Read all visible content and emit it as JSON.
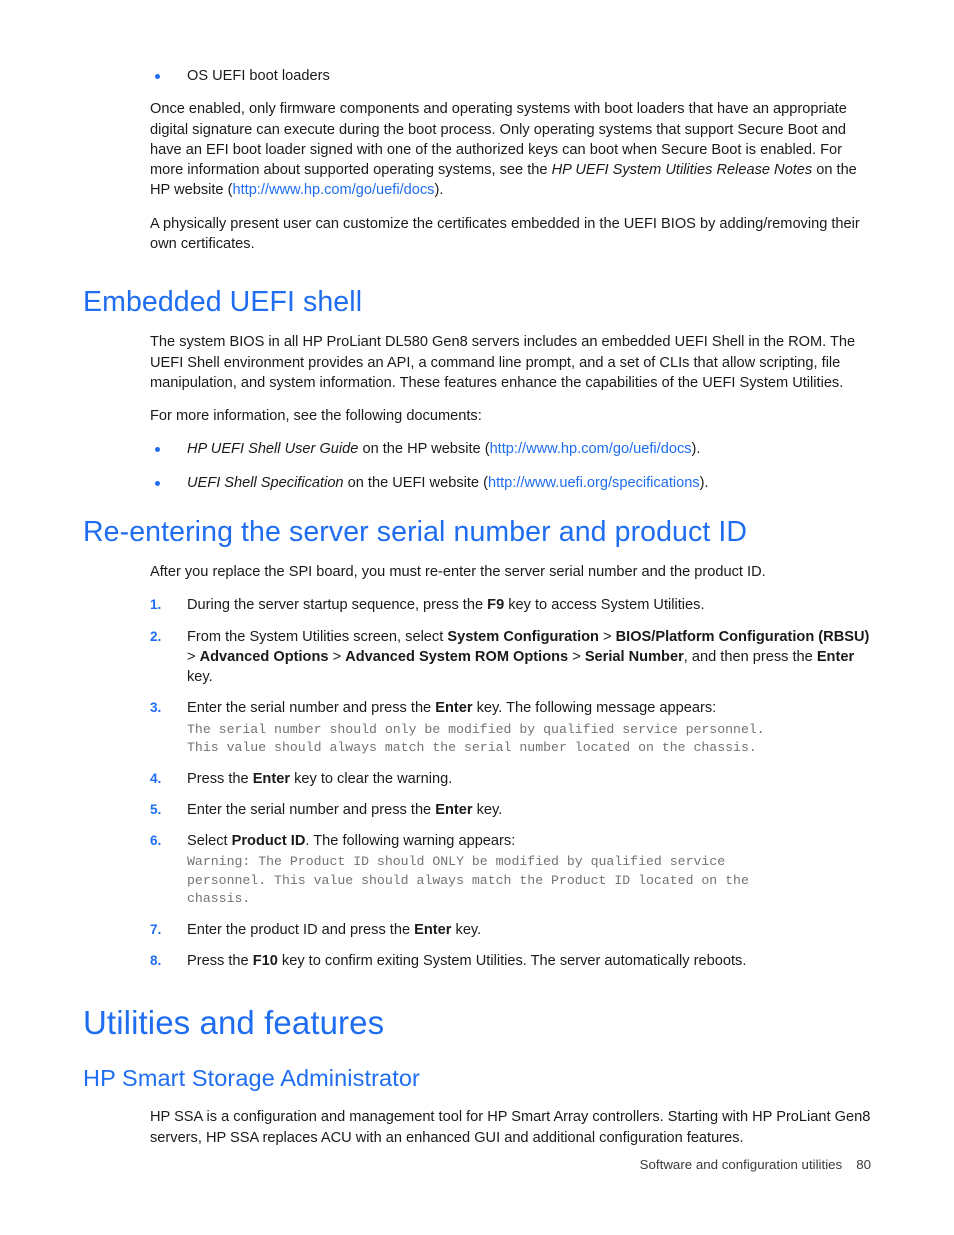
{
  "document": {
    "intro_bullet": "OS UEFI boot loaders",
    "paragraph_secure_boot_a": "Once enabled, only firmware components and operating systems with boot loaders that have an appropriate digital signature can execute during the boot process. Only operating systems that support Secure Boot and have an EFI boot loader signed with one of the authorized keys can boot when Secure Boot is enabled. For more information about supported operating systems, see the ",
    "paragraph_secure_boot_italic": "HP UEFI System Utilities Release Notes",
    "paragraph_secure_boot_b": " on the HP website (",
    "paragraph_secure_boot_link": "http://www.hp.com/go/uefi/docs",
    "paragraph_secure_boot_c": ").",
    "paragraph_certificates": "A physically present user can customize the certificates embedded in the UEFI BIOS by adding/removing their own certificates."
  },
  "section_embedded_shell": {
    "heading": "Embedded UEFI shell",
    "paragraph_1": "The system BIOS in all HP ProLiant DL580 Gen8 servers includes an embedded UEFI Shell in the ROM. The UEFI Shell environment provides an API, a command line prompt, and a set of CLIs that allow scripting, file manipulation, and system information. These features enhance the capabilities of the UEFI System Utilities.",
    "paragraph_2": "For more information, see the following documents:",
    "bullets": [
      {
        "italic_title": "HP UEFI Shell User Guide",
        "text_before_link": " on the HP website (",
        "link": "http://www.hp.com/go/uefi/docs",
        "text_after_link": ")."
      },
      {
        "italic_title": "UEFI Shell Specification",
        "text_before_link": " on the UEFI website (",
        "link": "http://www.uefi.org/specifications",
        "text_after_link": ")."
      }
    ]
  },
  "section_reentering": {
    "heading": "Re-entering the server serial number and product ID",
    "intro": "After you replace the SPI board, you must re-enter the server serial number and the product ID.",
    "steps": [
      {
        "number": "1.",
        "parts": [
          {
            "type": "text",
            "value": "During the server startup sequence, press the "
          },
          {
            "type": "bold",
            "value": "F9"
          },
          {
            "type": "text",
            "value": " key to access System Utilities."
          }
        ]
      },
      {
        "number": "2.",
        "parts": [
          {
            "type": "text",
            "value": "From the System Utilities screen, select "
          },
          {
            "type": "bold",
            "value": "System Configuration"
          },
          {
            "type": "text",
            "value": " > "
          },
          {
            "type": "bold",
            "value": "BIOS/Platform Configuration (RBSU)"
          },
          {
            "type": "text",
            "value": " > "
          },
          {
            "type": "bold",
            "value": "Advanced Options"
          },
          {
            "type": "text",
            "value": " > "
          },
          {
            "type": "bold",
            "value": "Advanced System ROM Options"
          },
          {
            "type": "text",
            "value": " > "
          },
          {
            "type": "bold",
            "value": "Serial Number"
          },
          {
            "type": "text",
            "value": ", and then press the "
          },
          {
            "type": "bold",
            "value": "Enter"
          },
          {
            "type": "text",
            "value": " key."
          }
        ]
      },
      {
        "number": "3.",
        "parts": [
          {
            "type": "text",
            "value": "Enter the serial number and press the "
          },
          {
            "type": "bold",
            "value": "Enter"
          },
          {
            "type": "text",
            "value": " key. The following message appears:"
          }
        ],
        "message": "The serial number should only be modified by qualified service personnel.\nThis value should always match the serial number located on the chassis."
      },
      {
        "number": "4.",
        "parts": [
          {
            "type": "text",
            "value": "Press the "
          },
          {
            "type": "bold",
            "value": "Enter"
          },
          {
            "type": "text",
            "value": " key to clear the warning."
          }
        ]
      },
      {
        "number": "5.",
        "parts": [
          {
            "type": "text",
            "value": "Enter the serial number and press the "
          },
          {
            "type": "bold",
            "value": "Enter"
          },
          {
            "type": "text",
            "value": " key."
          }
        ]
      },
      {
        "number": "6.",
        "parts": [
          {
            "type": "text",
            "value": "Select "
          },
          {
            "type": "bold",
            "value": "Product ID"
          },
          {
            "type": "text",
            "value": ". The following warning appears:"
          }
        ],
        "message": "Warning: The Product ID should ONLY be modified by qualified service\npersonnel. This value should always match the Product ID located on the\nchassis."
      },
      {
        "number": "7.",
        "parts": [
          {
            "type": "text",
            "value": "Enter the product ID and press the "
          },
          {
            "type": "bold",
            "value": "Enter"
          },
          {
            "type": "text",
            "value": " key."
          }
        ]
      },
      {
        "number": "8.",
        "parts": [
          {
            "type": "text",
            "value": "Press the "
          },
          {
            "type": "bold",
            "value": "F10"
          },
          {
            "type": "text",
            "value": " key to confirm exiting System Utilities. The server automatically reboots."
          }
        ]
      }
    ]
  },
  "section_utilities": {
    "heading": "Utilities and features",
    "subsection_heading": "HP Smart Storage Administrator",
    "paragraph": "HP SSA is a configuration and management tool for HP Smart Array controllers. Starting with HP ProLiant Gen8 servers, HP SSA replaces ACU with an enhanced GUI and additional configuration features."
  },
  "footer": {
    "title": "Software and configuration utilities",
    "page_number": "80"
  },
  "colors": {
    "heading_blue": "#1f6df0",
    "link_blue": "#1f6df0",
    "body_text": "#1a1a1a",
    "mono_text": "#737373",
    "page_background": "#ffffff"
  }
}
